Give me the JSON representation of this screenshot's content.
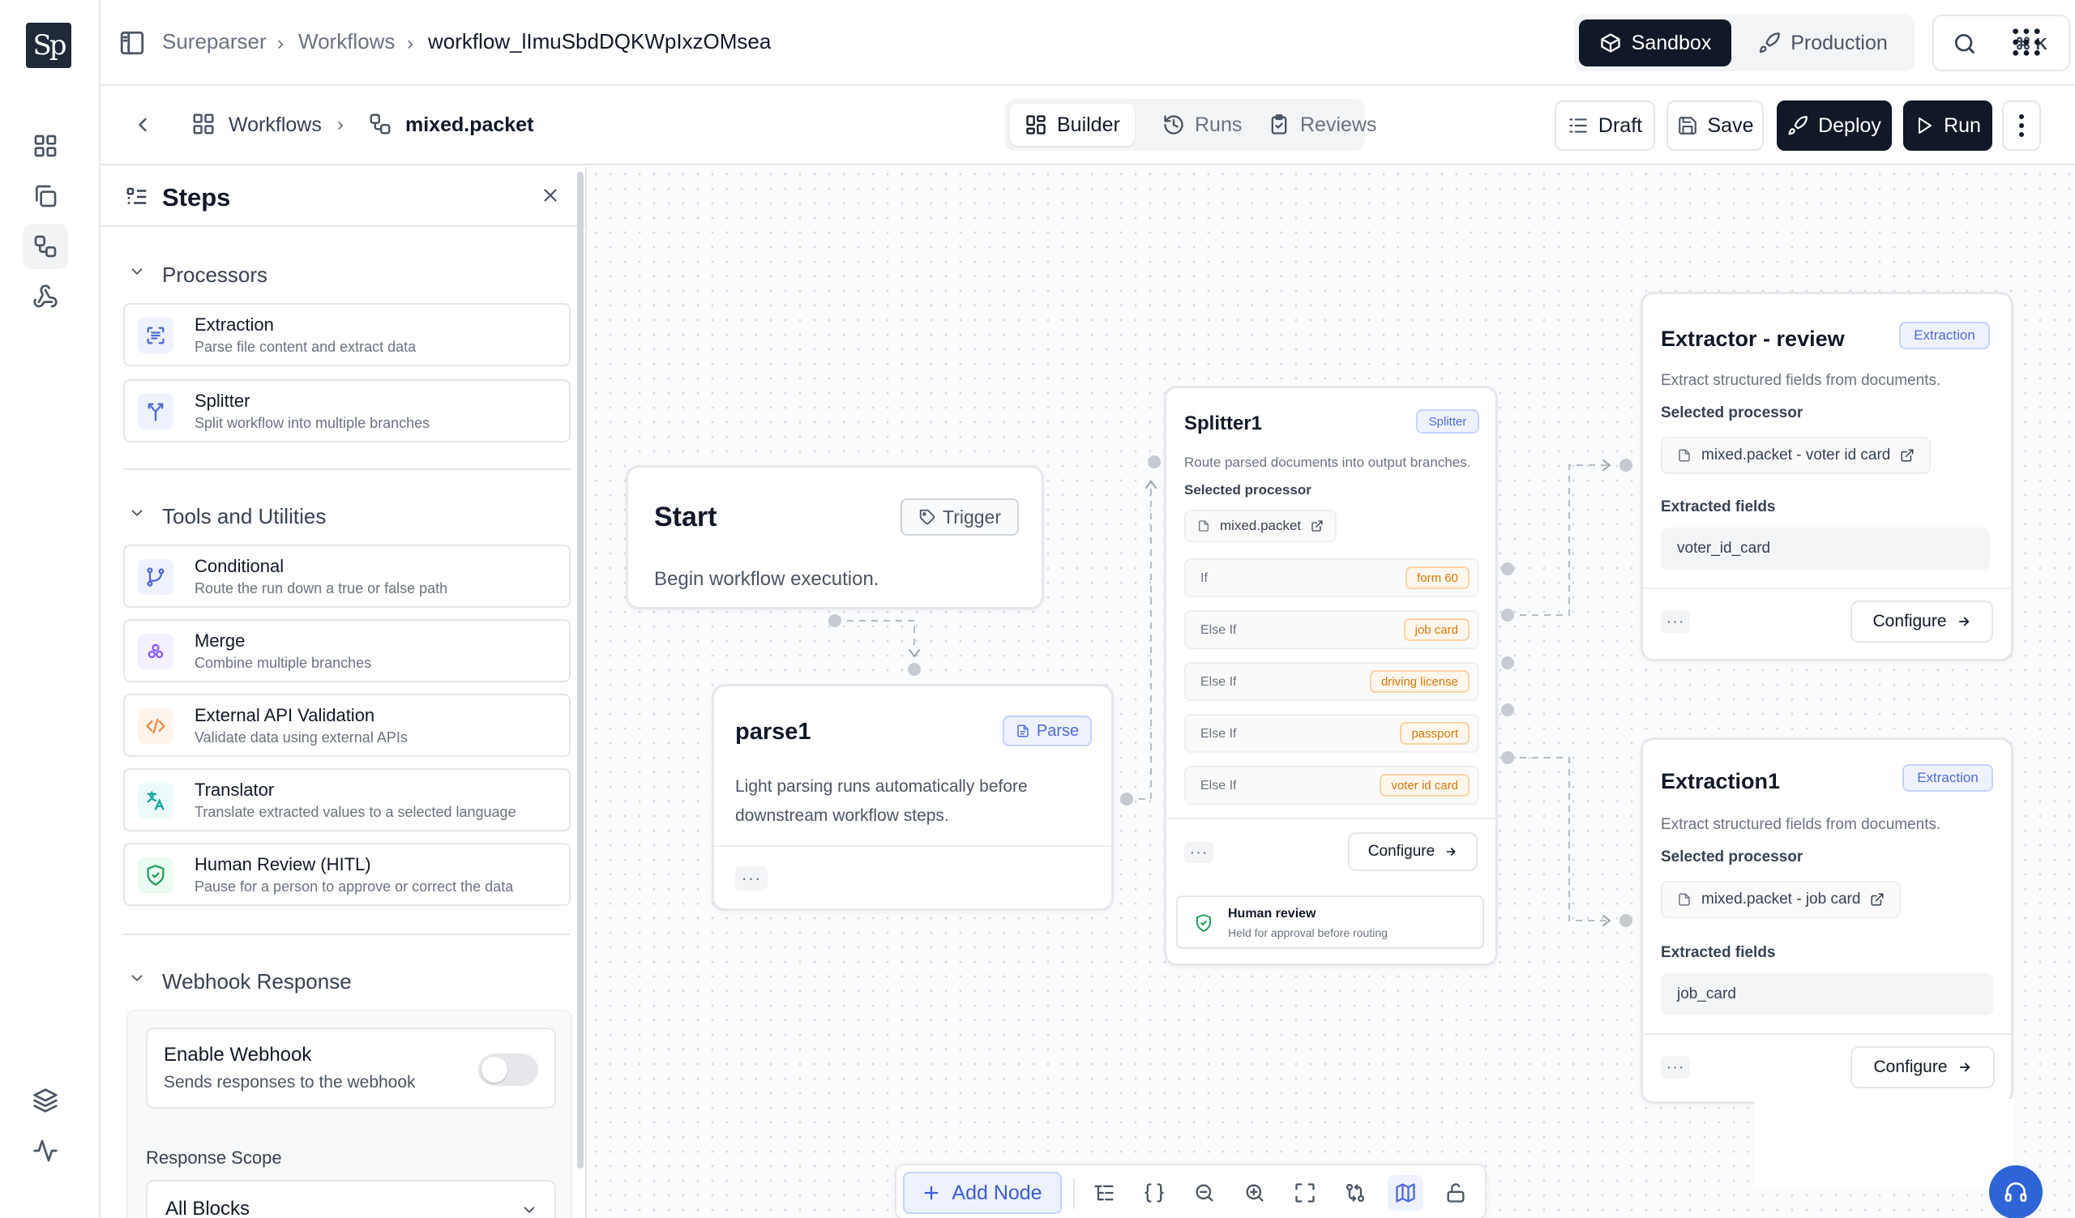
{
  "brand": {
    "logo_text": "Sp"
  },
  "breadcrumb": {
    "items": [
      "Sureparser",
      "Workflows",
      "workflow_lImuSbdDQKWpIxzOMsea"
    ]
  },
  "environment": {
    "sandbox": "Sandbox",
    "production": "Production",
    "active": "Sandbox"
  },
  "search": {
    "shortcut": "⌘ K"
  },
  "subbar": {
    "crumb_workflows": "Workflows",
    "crumb_packet": "mixed.packet",
    "tabs": [
      {
        "label": "Builder",
        "active": true
      },
      {
        "label": "Runs",
        "active": false
      },
      {
        "label": "Reviews",
        "active": false
      }
    ],
    "draft": "Draft",
    "save": "Save",
    "deploy": "Deploy",
    "run": "Run"
  },
  "steps": {
    "title": "Steps",
    "processors_title": "Processors",
    "processors": [
      {
        "title": "Extraction",
        "desc": "Parse file content and extract data",
        "icon": "extraction-icon"
      },
      {
        "title": "Splitter",
        "desc": "Split workflow into multiple branches",
        "icon": "splitter-icon"
      }
    ],
    "tools_title": "Tools and Utilities",
    "tools": [
      {
        "title": "Conditional",
        "desc": "Route the run down a true or false path",
        "icon": "branch-icon"
      },
      {
        "title": "Merge",
        "desc": "Combine multiple branches",
        "icon": "merge-icon"
      },
      {
        "title": "External API Validation",
        "desc": "Validate data using external APIs",
        "icon": "code-icon"
      },
      {
        "title": "Translator",
        "desc": "Translate extracted values to a selected language",
        "icon": "translate-icon"
      },
      {
        "title": "Human Review (HITL)",
        "desc": "Pause for a person to approve or correct the data",
        "icon": "shield-check-icon"
      }
    ],
    "webhook_title": "Webhook Response",
    "enable_title": "Enable Webhook",
    "enable_desc": "Sends responses to the webhook",
    "webhook_enabled": false,
    "scope_label": "Response Scope",
    "scope_value": "All Blocks"
  },
  "nodes": {
    "start": {
      "title": "Start",
      "badge": "Trigger",
      "desc": "Begin workflow execution."
    },
    "parse": {
      "title": "parse1",
      "badge": "Parse",
      "desc_line1": "Light parsing runs automatically before",
      "desc_line2": "downstream workflow steps.",
      "more": "···"
    },
    "splitter": {
      "title": "Splitter1",
      "badge": "Splitter",
      "desc": "Route parsed documents into output branches.",
      "selected_label": "Selected processor",
      "processor": "mixed.packet",
      "conditions": [
        {
          "label": "If",
          "tag": "form 60"
        },
        {
          "label": "Else If",
          "tag": "job card"
        },
        {
          "label": "Else If",
          "tag": "driving license"
        },
        {
          "label": "Else If",
          "tag": "passport"
        },
        {
          "label": "Else If",
          "tag": "voter id card"
        }
      ],
      "more": "···",
      "configure": "Configure",
      "review_title": "Human review",
      "review_desc": "Held for approval before routing"
    },
    "extractor_review": {
      "title": "Extractor - review",
      "badge": "Extraction",
      "desc": "Extract structured fields from documents.",
      "selected_label": "Selected processor",
      "processor": "mixed.packet - voter id card",
      "fields_label": "Extracted fields",
      "field": "voter_id_card",
      "more": "···",
      "configure": "Configure"
    },
    "extraction1": {
      "title": "Extraction1",
      "badge": "Extraction",
      "desc": "Extract structured fields from documents.",
      "selected_label": "Selected processor",
      "processor": "mixed.packet - job card",
      "fields_label": "Extracted fields",
      "field": "job_card",
      "more": "···",
      "configure": "Configure"
    }
  },
  "toolbar": {
    "add_node": "Add Node"
  },
  "colors": {
    "accent": "#3b5bdb",
    "dark": "#111827",
    "tag_orange": "#d97706"
  }
}
